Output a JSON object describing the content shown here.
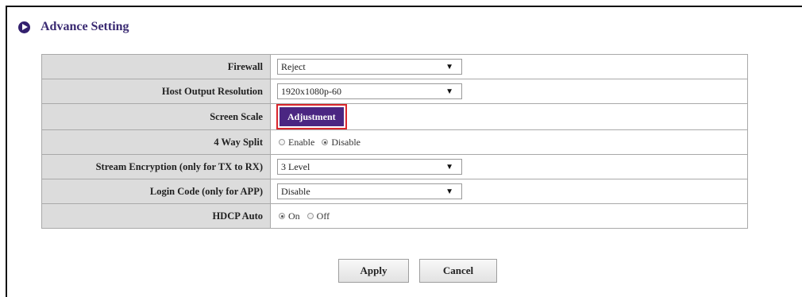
{
  "header": {
    "title": "Advance Setting",
    "icon": "play-circle-icon"
  },
  "rows": [
    {
      "label": "Firewall",
      "type": "select",
      "value": "Reject"
    },
    {
      "label": "Host Output Resolution",
      "type": "select",
      "value": "1920x1080p-60"
    },
    {
      "label": "Screen Scale",
      "type": "button",
      "value": "Adjustment"
    },
    {
      "label": "4 Way Split",
      "type": "radio",
      "options": [
        "Enable",
        "Disable"
      ],
      "selected": "Disable"
    },
    {
      "label": "Stream Encryption (only for TX to RX)",
      "type": "select",
      "value": "3 Level"
    },
    {
      "label": "Login Code (only for APP)",
      "type": "select",
      "value": "Disable"
    },
    {
      "label": "HDCP Auto",
      "type": "radio",
      "options": [
        "On",
        "Off"
      ],
      "selected": "On"
    }
  ],
  "actions": {
    "apply_label": "Apply",
    "cancel_label": "Cancel"
  },
  "colors": {
    "accent": "#4b2682",
    "highlight": "#d9262c",
    "label_bg": "#dcdcdc"
  }
}
